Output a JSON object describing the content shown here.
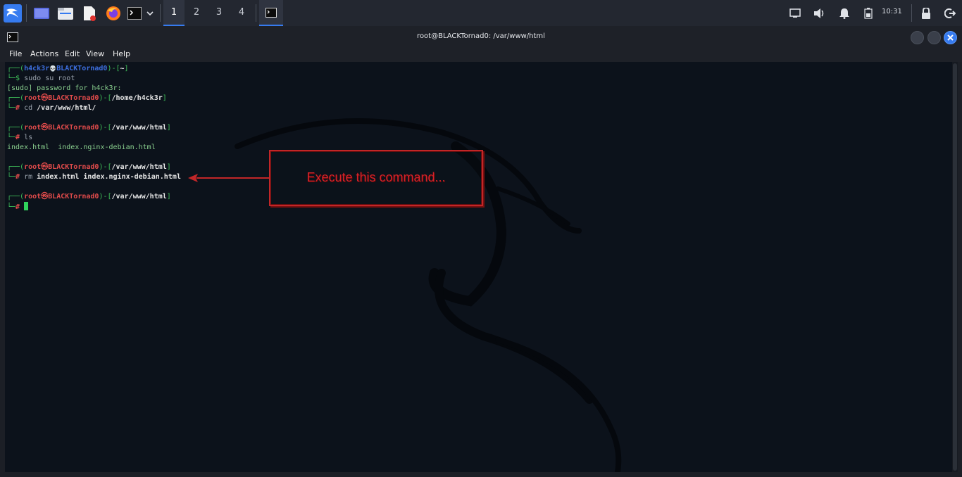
{
  "taskbar": {
    "apps": [
      "kali-menu-icon",
      "workspace-show-desktop-icon",
      "file-manager-icon",
      "text-editor-icon",
      "firefox-icon",
      "terminal-icon",
      "chevron-down-icon"
    ],
    "workspaces": [
      "1",
      "2",
      "3",
      "4"
    ],
    "active_workspace": "1",
    "tray": [
      "display-icon",
      "volume-icon",
      "notification-bell-icon",
      "battery-icon"
    ],
    "clock": "10:31",
    "session": [
      "lock-icon",
      "logout-icon"
    ]
  },
  "window": {
    "title": "root@BLACKTornad0: /var/www/html",
    "menu": [
      "File",
      "Actions",
      "Edit",
      "View",
      "Help"
    ]
  },
  "terminal": {
    "l1": {
      "open": "┌──(",
      "user": "h4ck3r",
      "skull": "💀",
      "host": "BLACKTornad0",
      "close": ")-[",
      "dir": "~",
      "end": "]"
    },
    "l2": {
      "prompt": "└─$ ",
      "cmd": "sudo su root"
    },
    "l3": {
      "text": "[sudo] password for h4ck3r:"
    },
    "l4": {
      "open": "┌──(",
      "user": "root",
      "at": "㉿",
      "host": "BLACKTornad0",
      "close": ")-[",
      "dir": "/home/h4ck3r",
      "end": "]"
    },
    "l5": {
      "prompt": "└─",
      "hash": "# ",
      "cmd": "cd",
      "arg": " /var/www/html/"
    },
    "l7": {
      "open": "┌──(",
      "user": "root",
      "at": "㉿",
      "host": "BLACKTornad0",
      "close": ")-[",
      "dir": "/var/www/html",
      "end": "]"
    },
    "l8": {
      "prompt": "└─",
      "hash": "# ",
      "cmd": "ls"
    },
    "l9": {
      "text": "index.html  index.nginx-debian.html"
    },
    "l11": {
      "open": "┌──(",
      "user": "root",
      "at": "㉿",
      "host": "BLACKTornad0",
      "close": ")-[",
      "dir": "/var/www/html",
      "end": "]"
    },
    "l12": {
      "prompt": "└─",
      "hash": "# ",
      "cmd": "rm",
      "arg": " index.html index.nginx-debian.html"
    },
    "l14": {
      "open": "┌──(",
      "user": "root",
      "at": "㉿",
      "host": "BLACKTornad0",
      "close": ")-[",
      "dir": "/var/www/html",
      "end": "]"
    },
    "l15": {
      "prompt": "└─",
      "hash": "# "
    }
  },
  "annotation": {
    "text": "Execute this command...",
    "color": "#d4232a"
  }
}
